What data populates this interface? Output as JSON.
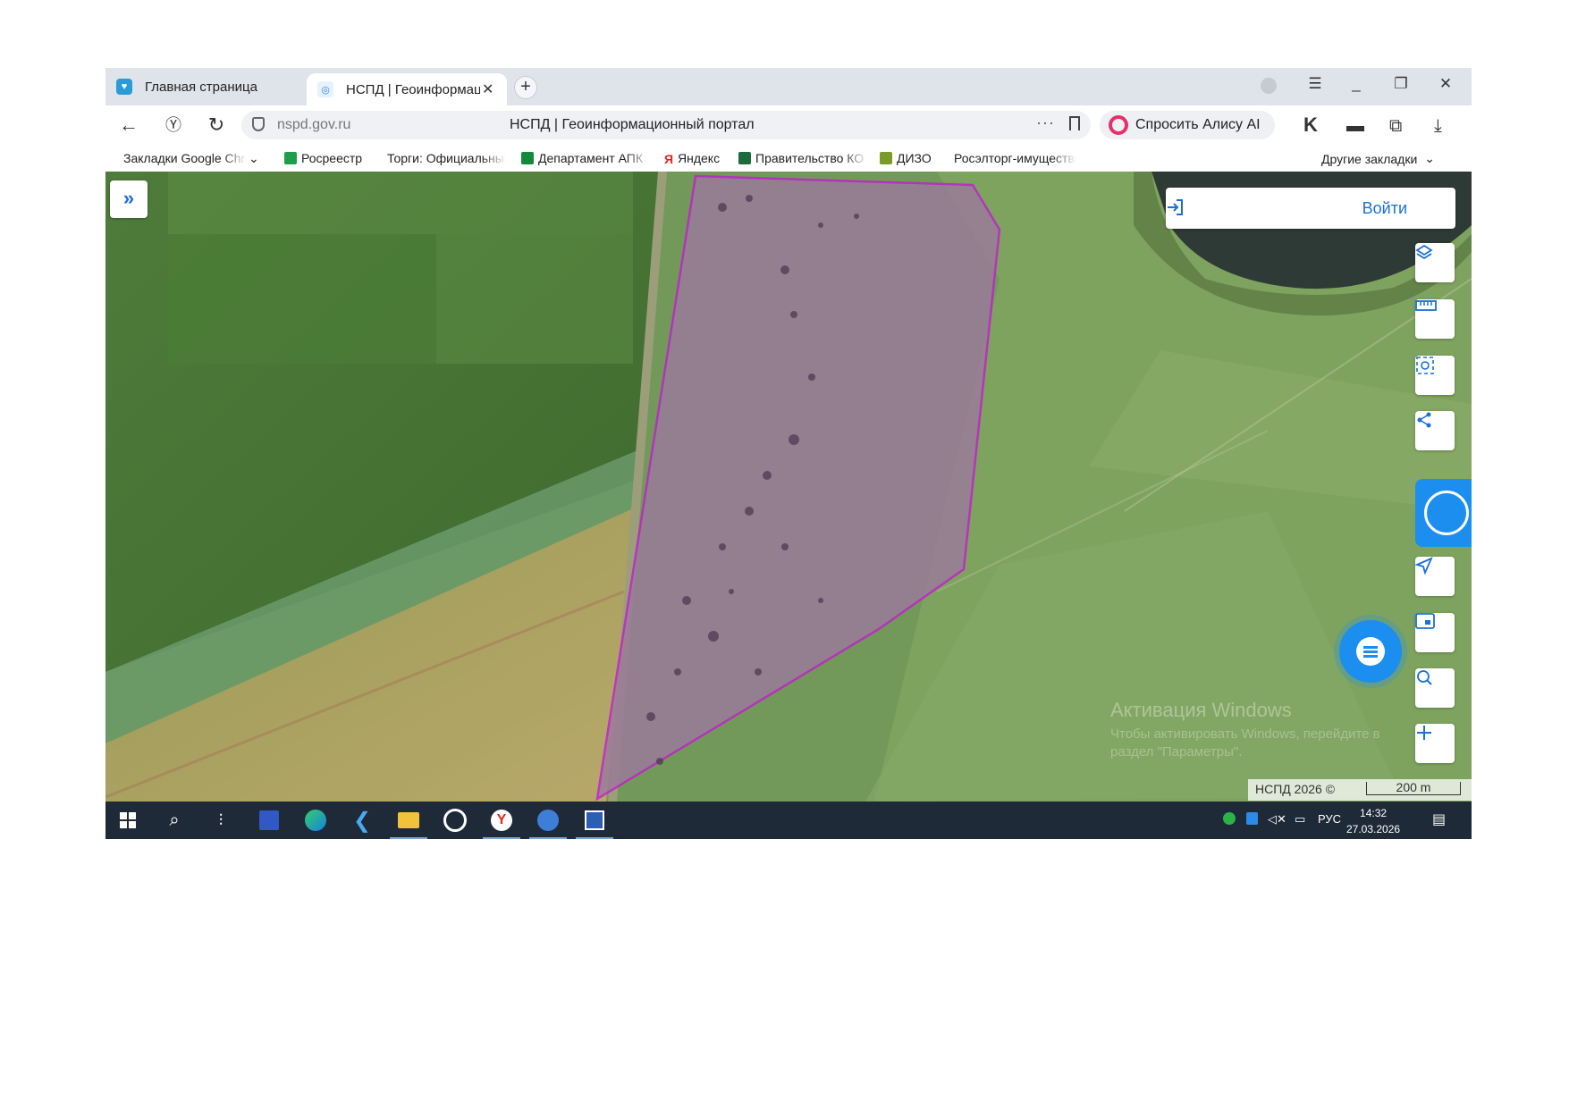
{
  "browser": {
    "tabs": [
      {
        "label": "Главная страница",
        "active": false
      },
      {
        "label": "НСПД | Геоинформационный портал",
        "active": true
      }
    ],
    "address": {
      "url": "nspd.gov.ru",
      "page_title": "НСПД | Геоинформационный портал"
    },
    "alisa_label": "Спросить Алису AI",
    "bookmarks": [
      {
        "label": "Закладки Google Chrome",
        "color": "#ffffff"
      },
      {
        "label": "Росреестр",
        "color": "#1e9e4a"
      },
      {
        "label": "Торги: Официальный",
        "color": "#3a7bd5"
      },
      {
        "label": "Департамент АПК",
        "color": "#138a3a"
      },
      {
        "label": "Яндекс",
        "color": "#e52620"
      },
      {
        "label": "Правительство КО",
        "color": "#1c6b3a"
      },
      {
        "label": "ДИЗО",
        "color": "#7a9a2a"
      },
      {
        "label": "Росэлторг-имущество",
        "color": "#2c5fb0"
      }
    ],
    "other_bookmarks": "Другие закладки"
  },
  "map": {
    "login_label": "Войти",
    "tools": [
      "layers-icon",
      "ruler-icon",
      "select-area-icon",
      "share-icon",
      "navigate-icon",
      "minimap-icon",
      "search-location-icon",
      "zoom-in-icon"
    ],
    "watermark_title": "Активация Windows",
    "watermark_text": "Чтобы активировать Windows, перейдите в раздел \"Параметры\".",
    "attribution": "НСПД 2026 ©",
    "scale_label": "200 m",
    "colors": {
      "parcel_outline": "#c21fd0",
      "accent": "#1b6fd9"
    }
  },
  "taskbar": {
    "language": "РУС",
    "time": "14:32",
    "date": "27.03.2026"
  }
}
